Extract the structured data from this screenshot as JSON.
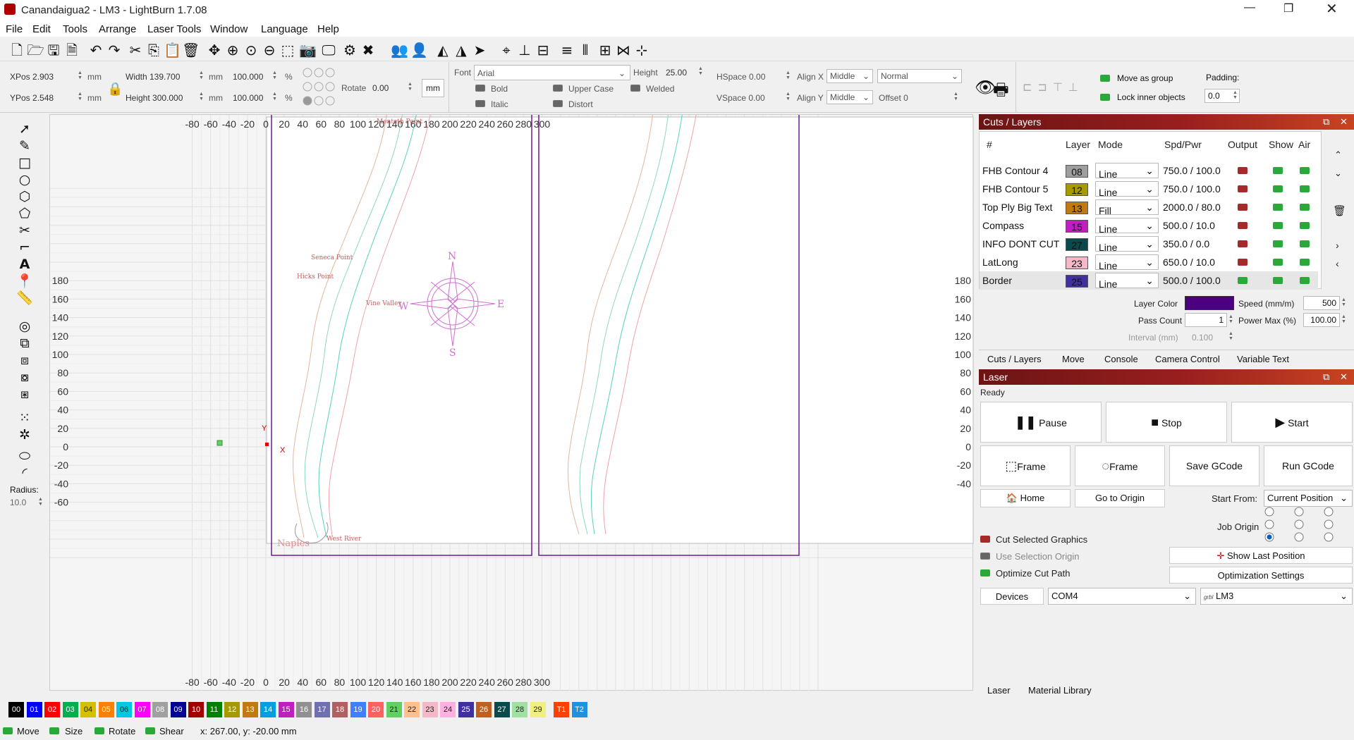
{
  "window": {
    "title": "Canandaigua2 - LM3 - LightBurn 1.7.08"
  },
  "menu": [
    "File",
    "Edit",
    "Tools",
    "Arrange",
    "Laser Tools",
    "Window",
    "Language",
    "Help"
  ],
  "toolbar2": {
    "xpos": "XPos 2.903",
    "ypos": "YPos 2.548",
    "width": "Width 139.700",
    "height": "Height 300.000",
    "unit": "mm",
    "pct_w": "100.000",
    "pct_h": "100.000",
    "pct": "%",
    "rotate_label": "Rotate",
    "rotate": "0.00",
    "mm_button": "mm",
    "font_label": "Font",
    "font": "Arial",
    "height_label": "Height",
    "font_height": "25.00",
    "bold": "Bold",
    "italic": "Italic",
    "upper": "Upper Case",
    "distort": "Distort",
    "welded": "Welded",
    "hspace": "HSpace 0.00",
    "vspace": "VSpace 0.00",
    "alignx": "Align X",
    "aligny": "Align Y",
    "alignx_val": "Middle",
    "aligny_val": "Middle",
    "normal": "Normal",
    "offset": "Offset 0",
    "move_group": "Move as group",
    "lock_inner": "Lock inner objects",
    "padding_label": "Padding:",
    "padding": "0.0"
  },
  "left_tools": {
    "radius_label": "Radius:",
    "radius": "10.0"
  },
  "canvas": {
    "x_ticks": [
      "-80",
      "-60",
      "-40",
      "-20",
      "0",
      "20",
      "40",
      "60",
      "80",
      "100",
      "120",
      "140",
      "160",
      "180",
      "200",
      "220",
      "240",
      "260",
      "280",
      "300"
    ],
    "y_ticks": [
      "180",
      "160",
      "140",
      "120",
      "100",
      "80",
      "60",
      "40",
      "20",
      "0",
      "-20",
      "-40",
      "-60"
    ],
    "y_ticks_right": [
      "180",
      "160",
      "140",
      "120",
      "100",
      "80",
      "60",
      "40",
      "20",
      "0",
      "-20",
      "-40"
    ],
    "labels": {
      "mendon": "Menteth Point",
      "seneca": "Seneca Point",
      "hicks": "Hicks Point",
      "vine": "Vine Valley",
      "naples": "Naples",
      "westriver": "West River"
    },
    "compass": {
      "n": "N",
      "s": "S",
      "e": "E",
      "w": "W"
    },
    "axis_x": "X",
    "axis_y": "Y"
  },
  "cuts": {
    "title": "Cuts / Layers",
    "columns": [
      "#",
      "Layer",
      "Mode",
      "Spd/Pwr",
      "Output",
      "Show",
      "Air"
    ],
    "rows": [
      {
        "name": "FHB Contour 4",
        "layer": "08",
        "color": "#9e9e9e",
        "mode": "Line",
        "sp": "750.0 / 100.0",
        "output": "red"
      },
      {
        "name": "FHB Contour 5",
        "layer": "12",
        "color": "#a69a00",
        "mode": "Line",
        "sp": "750.0 / 100.0",
        "output": "red"
      },
      {
        "name": "Top Ply Big Text",
        "layer": "13",
        "color": "#c07a10",
        "mode": "Fill",
        "sp": "2000.0 / 80.0",
        "output": "red"
      },
      {
        "name": "Compass",
        "layer": "15",
        "color": "#c01ec0",
        "mode": "Line",
        "sp": "500.0 / 10.0",
        "output": "red"
      },
      {
        "name": "INFO DONT CUT",
        "layer": "27",
        "color": "#0a4a4a",
        "mode": "Line",
        "sp": "350.0 / 0.0",
        "output": "red"
      },
      {
        "name": "LatLong",
        "layer": "23",
        "color": "#f5b8c8",
        "mode": "Line",
        "sp": "650.0 / 10.0",
        "output": "red"
      },
      {
        "name": "Border",
        "layer": "25",
        "color": "#4030a0",
        "mode": "Line",
        "sp": "500.0 / 100.0",
        "output": "on"
      }
    ],
    "layer_color_label": "Layer Color",
    "layer_color": "#4b0082",
    "speed_label": "Speed (mm/m)",
    "speed": "500",
    "pass_label": "Pass Count",
    "pass": "1",
    "power_label": "Power Max (%)",
    "power": "100.00",
    "interval_label": "Interval (mm)",
    "interval": "0.100",
    "tabs": [
      "Cuts / Layers",
      "Move",
      "Console",
      "Camera Control",
      "Variable Text"
    ]
  },
  "laser": {
    "title": "Laser",
    "status": "Ready",
    "pause": "Pause",
    "stop": "Stop",
    "start": "Start",
    "frame1": "Frame",
    "frame2": "Frame",
    "save_gcode": "Save GCode",
    "run_gcode": "Run GCode",
    "home": "Home",
    "goto_origin": "Go to Origin",
    "start_from_label": "Start From:",
    "start_from": "Current Position",
    "job_origin": "Job Origin",
    "cut_selected": "Cut Selected Graphics",
    "use_selection": "Use Selection Origin",
    "optimize": "Optimize Cut Path",
    "show_last": "Show Last Position",
    "opt_settings": "Optimization Settings",
    "devices": "Devices",
    "port": "COM4",
    "device": "LM3",
    "grbl": "grbl"
  },
  "bottom_tabs": [
    "Laser",
    "Material Library"
  ],
  "palette": [
    {
      "l": "00",
      "c": "#000000"
    },
    {
      "l": "01",
      "c": "#0000ff"
    },
    {
      "l": "02",
      "c": "#ff0000"
    },
    {
      "l": "03",
      "c": "#00b050"
    },
    {
      "l": "04",
      "c": "#d4c000"
    },
    {
      "l": "05",
      "c": "#ff7f00"
    },
    {
      "l": "06",
      "c": "#00c8e0"
    },
    {
      "l": "07",
      "c": "#ff00ff"
    },
    {
      "l": "08",
      "c": "#a0a0a0"
    },
    {
      "l": "09",
      "c": "#000090"
    },
    {
      "l": "10",
      "c": "#a00000"
    },
    {
      "l": "11",
      "c": "#008000"
    },
    {
      "l": "12",
      "c": "#a69a00"
    },
    {
      "l": "13",
      "c": "#c07a10"
    },
    {
      "l": "14",
      "c": "#00a0e0"
    },
    {
      "l": "15",
      "c": "#c01ec0"
    },
    {
      "l": "16",
      "c": "#909090"
    },
    {
      "l": "17",
      "c": "#7070b0"
    },
    {
      "l": "18",
      "c": "#b06060"
    },
    {
      "l": "19",
      "c": "#4080ff"
    },
    {
      "l": "20",
      "c": "#ff6060"
    },
    {
      "l": "21",
      "c": "#60d060"
    },
    {
      "l": "22",
      "c": "#ffc090"
    },
    {
      "l": "23",
      "c": "#f5b8c8"
    },
    {
      "l": "24",
      "c": "#ffb0e0"
    },
    {
      "l": "25",
      "c": "#4030a0"
    },
    {
      "l": "26",
      "c": "#c06020"
    },
    {
      "l": "27",
      "c": "#0a4a4a"
    },
    {
      "l": "28",
      "c": "#a0e0a0"
    },
    {
      "l": "29",
      "c": "#f0f080"
    },
    {
      "l": "T1",
      "c": "#ff4000"
    },
    {
      "l": "T2",
      "c": "#2090e0"
    }
  ],
  "status": {
    "move": "Move",
    "size": "Size",
    "rotate": "Rotate",
    "shear": "Shear",
    "coords": "x: 267.00, y: -20.00 mm"
  }
}
